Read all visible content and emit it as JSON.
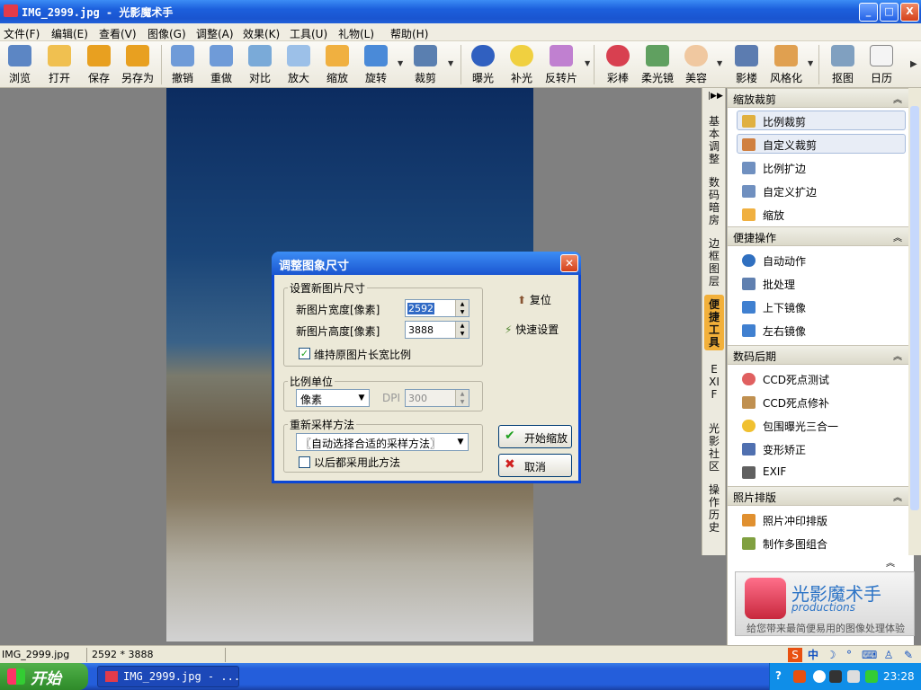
{
  "window": {
    "title": "IMG_2999.jpg - 光影魔术手",
    "controls": [
      "_",
      "□",
      "X"
    ]
  },
  "menu": [
    "文件(F)",
    "编辑(E)",
    "查看(V)",
    "图像(G)",
    "调整(A)",
    "效果(K)",
    "工具(U)",
    "礼物(L)",
    "帮助(H)"
  ],
  "toolbar": [
    "浏览",
    "打开",
    "保存",
    "另存为",
    "撤销",
    "重做",
    "对比",
    "放大",
    "缩放",
    "旋转",
    "裁剪",
    "曝光",
    "补光",
    "反转片",
    "彩棒",
    "柔光镜",
    "美容",
    "影楼",
    "风格化",
    "抠图",
    "日历"
  ],
  "side_tabs": [
    "基本调整",
    "数码暗房",
    "边框图层",
    "便捷工具",
    "EXIF",
    "光影社区",
    "操作历史"
  ],
  "panel": {
    "sections": [
      {
        "title": "缩放裁剪",
        "items": [
          "比例裁剪",
          "自定义裁剪",
          "比例扩边",
          "自定义扩边",
          "缩放"
        ]
      },
      {
        "title": "便捷操作",
        "items": [
          "自动动作",
          "批处理",
          "上下镜像",
          "左右镜像"
        ]
      },
      {
        "title": "数码后期",
        "items": [
          "CCD死点测试",
          "CCD死点修补",
          "包围曝光三合一",
          "变形矫正",
          "EXIF"
        ]
      },
      {
        "title": "照片排版",
        "items": [
          "照片冲印排版",
          "制作多图组合"
        ]
      }
    ],
    "logo": {
      "name": "光影魔术手",
      "sub": "productions",
      "slogan": "给您带来最简便易用的图像处理体验"
    }
  },
  "dialog": {
    "title": "调整图象尺寸",
    "group1": "设置新图片尺寸",
    "width_label": "新图片宽度[像素]",
    "width_value": "2592",
    "height_label": "新图片高度[像素]",
    "height_value": "3888",
    "keep_ratio": "维持原图片长宽比例",
    "group2": "比例单位",
    "unit": "像素",
    "dpi_label": "DPI",
    "dpi_value": "300",
    "group3": "重新采样方法",
    "resample": "〖自动选择合适的采样方法〗",
    "always": "以后都采用此方法",
    "reset": "复位",
    "quick": "快速设置",
    "start": "开始缩放",
    "cancel": "取消"
  },
  "status": {
    "file": "IMG_2999.jpg",
    "dims": "2592 * 3888"
  },
  "taskbar": {
    "start": "开始",
    "task": "IMG_2999.jpg - ...",
    "time": "23:28"
  },
  "ime": [
    "S",
    "中",
    "☽",
    "°",
    "⌨",
    "♙",
    "✎"
  ],
  "colors": {
    "accent": "#316ac5",
    "titlebar": "#1c5fdc",
    "active_tab": "#f2b03a"
  }
}
